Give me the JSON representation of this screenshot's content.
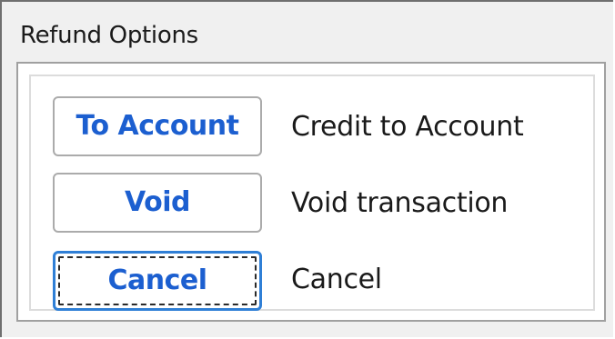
{
  "window": {
    "title": "Refund Options"
  },
  "options": [
    {
      "button_label": "To Account",
      "description": "Credit to Account"
    },
    {
      "button_label": "Void",
      "description": "Void transaction"
    },
    {
      "button_label": "Cancel",
      "description": "Cancel"
    }
  ],
  "colors": {
    "button_text": "#1c5fd0",
    "focus_border": "#2f7fd6"
  }
}
